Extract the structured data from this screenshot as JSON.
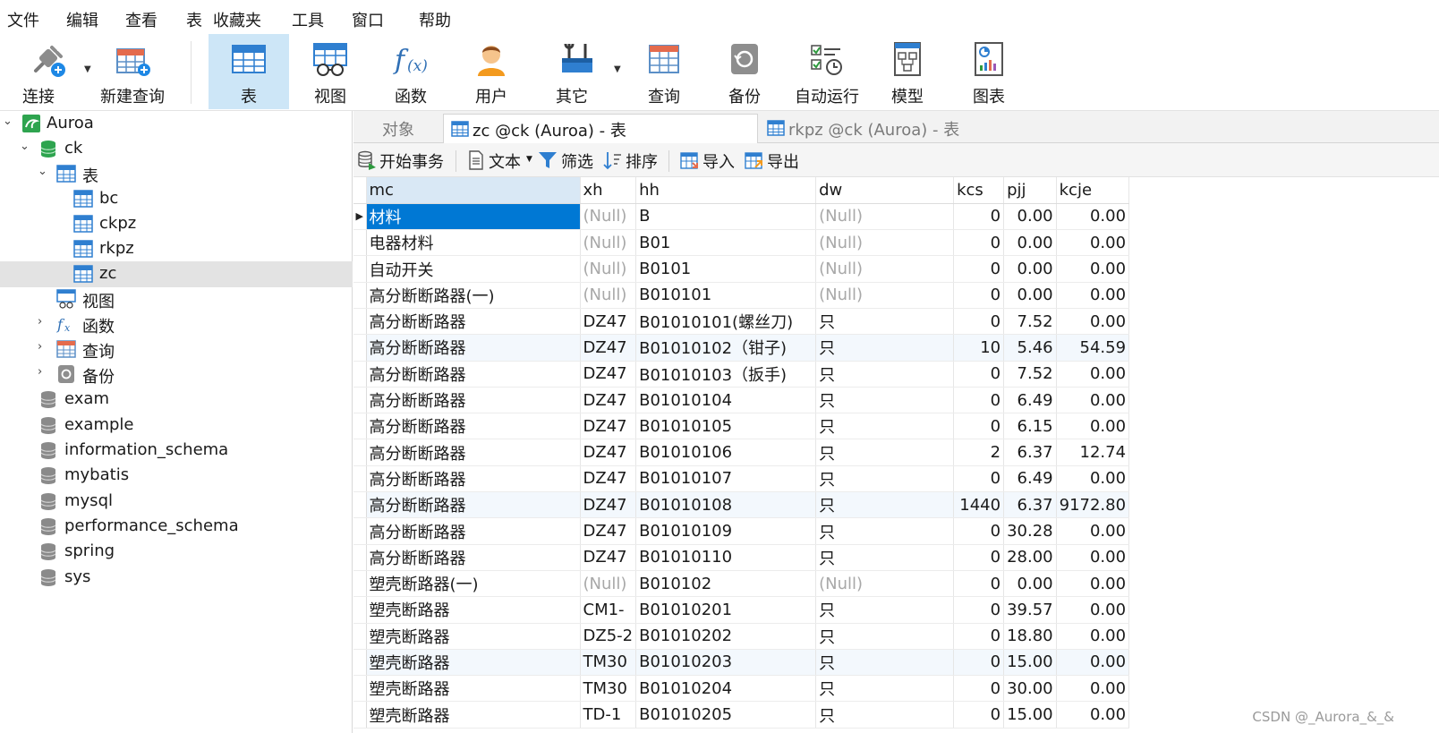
{
  "menu": [
    "文件",
    "编辑",
    "查看",
    "表",
    "收藏夹",
    "工具",
    "窗口",
    "帮助"
  ],
  "toolbar": {
    "connect": "连接",
    "new_query": "新建查询",
    "table": "表",
    "view": "视图",
    "function": "函数",
    "user": "用户",
    "other": "其它",
    "query": "查询",
    "backup": "备份",
    "auto_run": "自动运行",
    "model": "模型",
    "chart": "图表"
  },
  "sidebar": {
    "connection": "Auroa",
    "database": "ck",
    "tables_group": "表",
    "tables": [
      "bc",
      "ckpz",
      "rkpz",
      "zc"
    ],
    "views": "视图",
    "functions": "函数",
    "queries": "查询",
    "backups": "备份",
    "other_databases": [
      "exam",
      "example",
      "information_schema",
      "mybatis",
      "mysql",
      "performance_schema",
      "spring",
      "sys"
    ]
  },
  "tabs": {
    "objects": "对象",
    "tab1": "zc @ck (Auroa) - 表",
    "tab2": "rkpz @ck (Auroa) - 表"
  },
  "subtoolbar": {
    "begin_tx": "开始事务",
    "text": "文本",
    "filter": "筛选",
    "sort": "排序",
    "import": "导入",
    "export": "导出"
  },
  "grid": {
    "columns": [
      "mc",
      "xh",
      "hh",
      "dw",
      "kcs",
      "pjj",
      "kcje"
    ],
    "rows": [
      [
        "材料",
        "(Null)",
        "B",
        "(Null)",
        "0",
        "0.00",
        "0.00"
      ],
      [
        "电器材料",
        "(Null)",
        "B01",
        "(Null)",
        "0",
        "0.00",
        "0.00"
      ],
      [
        "自动开关",
        "(Null)",
        "B0101",
        "(Null)",
        "0",
        "0.00",
        "0.00"
      ],
      [
        "高分断断路器(一)",
        "(Null)",
        "B010101",
        "(Null)",
        "0",
        "0.00",
        "0.00"
      ],
      [
        "高分断断路器",
        "DZ47",
        "B01010101(螺丝刀)",
        "只",
        "0",
        "7.52",
        "0.00"
      ],
      [
        "高分断断路器",
        "DZ47",
        "B01010102（钳子)",
        "只",
        "10",
        "5.46",
        "54.59"
      ],
      [
        "高分断断路器",
        "DZ47",
        "B01010103（扳手)",
        "只",
        "0",
        "7.52",
        "0.00"
      ],
      [
        "高分断断路器",
        "DZ47",
        "B01010104",
        "只",
        "0",
        "6.49",
        "0.00"
      ],
      [
        "高分断断路器",
        "DZ47",
        "B01010105",
        "只",
        "0",
        "6.15",
        "0.00"
      ],
      [
        "高分断断路器",
        "DZ47",
        "B01010106",
        "只",
        "2",
        "6.37",
        "12.74"
      ],
      [
        "高分断断路器",
        "DZ47",
        "B01010107",
        "只",
        "0",
        "6.49",
        "0.00"
      ],
      [
        "高分断断路器",
        "DZ47",
        "B01010108",
        "只",
        "1440",
        "6.37",
        "9172.80"
      ],
      [
        "高分断断路器",
        "DZ47",
        "B01010109",
        "只",
        "0",
        "30.28",
        "0.00"
      ],
      [
        "高分断断路器",
        "DZ47",
        "B01010110",
        "只",
        "0",
        "28.00",
        "0.00"
      ],
      [
        "塑壳断路器(一)",
        "(Null)",
        "B010102",
        "(Null)",
        "0",
        "0.00",
        "0.00"
      ],
      [
        "塑壳断路器",
        "CM1-",
        "B01010201",
        "只",
        "0",
        "39.57",
        "0.00"
      ],
      [
        "塑壳断路器",
        "DZ5-2",
        "B01010202",
        "只",
        "0",
        "18.80",
        "0.00"
      ],
      [
        "塑壳断路器",
        "TM30",
        "B01010203",
        "只",
        "0",
        "15.00",
        "0.00"
      ],
      [
        "塑壳断路器",
        "TM30",
        "B01010204",
        "只",
        "0",
        "30.00",
        "0.00"
      ],
      [
        "塑壳断路器",
        "TD-1",
        "B01010205",
        "只",
        "0",
        "15.00",
        "0.00"
      ]
    ]
  },
  "watermark": "CSDN @_Aurora_&_&"
}
